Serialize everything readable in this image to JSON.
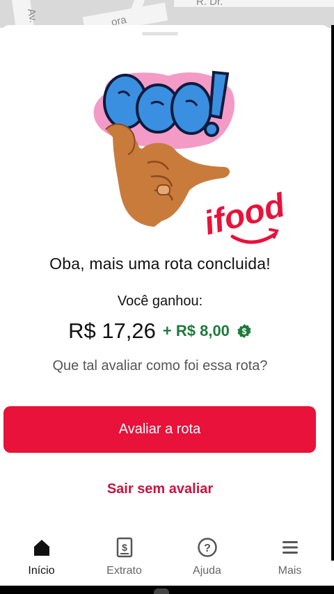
{
  "map": {
    "labels": [
      "Av.",
      "ora",
      "R. Dr."
    ]
  },
  "illustration": {
    "sticker_text": "BOA!",
    "brand": "ifood"
  },
  "result": {
    "title": "Oba, mais uma rota concluida!",
    "earned_label": "Você ganhou:",
    "amount": "R$ 17,26",
    "bonus": "+ R$ 8,00",
    "question": "Que tal avaliar como foi essa rota?"
  },
  "actions": {
    "rate_label": "Avaliar a rota",
    "skip_label": "Sair sem avaliar"
  },
  "nav": {
    "items": [
      {
        "label": "Início",
        "icon": "home-icon",
        "active": true
      },
      {
        "label": "Extrato",
        "icon": "statement-icon",
        "active": false
      },
      {
        "label": "Ajuda",
        "icon": "help-icon",
        "active": false
      },
      {
        "label": "Mais",
        "icon": "menu-icon",
        "active": false
      }
    ]
  },
  "colors": {
    "primary": "#e8123a",
    "bonus_green": "#1e7a3c",
    "link_red": "#c8143e"
  }
}
